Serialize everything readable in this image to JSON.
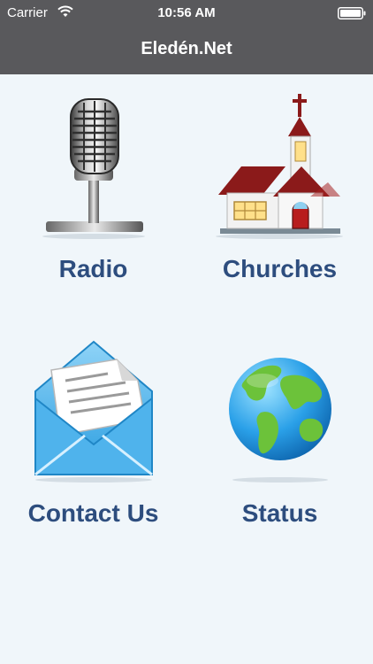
{
  "status_bar": {
    "carrier": "Carrier",
    "time": "10:56 AM",
    "wifi_icon": "wifi-icon",
    "battery_icon": "battery-icon"
  },
  "nav": {
    "title": "Eledén.Net"
  },
  "menu": [
    {
      "label": "Radio",
      "icon": "microphone-icon"
    },
    {
      "label": "Churches",
      "icon": "church-icon"
    },
    {
      "label": "Contact Us",
      "icon": "envelope-icon"
    },
    {
      "label": "Status",
      "icon": "globe-icon"
    }
  ],
  "colors": {
    "nav_background": "#59595c",
    "page_background": "#f0f6fa",
    "label_text": "#2d4d7e"
  }
}
